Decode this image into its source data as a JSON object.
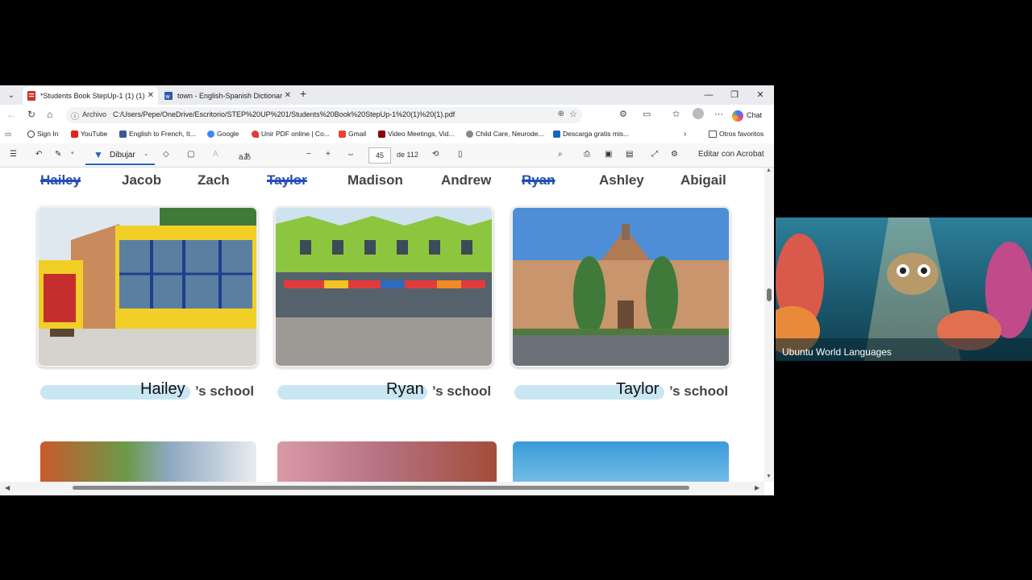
{
  "browser": {
    "tabs": [
      {
        "title": "*Students Book StepUp-1 (1) (1).p",
        "active": true
      },
      {
        "title": "town - English-Spanish Dictionar",
        "active": false
      }
    ],
    "address": {
      "label": "Archivo",
      "url": "C:/Users/Pepe/OneDrive/Escritorio/STEP%20UP%201/Students%20Book%20StepUp-1%20(1)%20(1).pdf"
    },
    "chat_label": "Chat",
    "bookmarks": [
      {
        "label": "Sign In",
        "color": "#333333"
      },
      {
        "label": "YouTube",
        "color": "#e62117"
      },
      {
        "label": "English to French, It...",
        "color": "#3b5998"
      },
      {
        "label": "Google",
        "color": "#4285f4"
      },
      {
        "label": "Unir PDF online | Co...",
        "color": "#e53935"
      },
      {
        "label": "Gmail",
        "color": "#ea4335"
      },
      {
        "label": "Video Meetings, Vid...",
        "color": "#8b0000"
      },
      {
        "label": "Child Care, Neurode...",
        "color": "#888888"
      },
      {
        "label": "Descarga gratis mis...",
        "color": "#1565c0"
      }
    ],
    "other_favorites": "Otros favoritos"
  },
  "pdf_toolbar": {
    "draw_label": "Dibujar",
    "page_current": "45",
    "page_total": "de 112",
    "read_aloud": "aあ",
    "edit_acrobat": "Editar con Acrobat"
  },
  "worksheet": {
    "names": [
      {
        "text": "Hailey",
        "struck": true
      },
      {
        "text": "Jacob",
        "struck": false
      },
      {
        "text": "Zach",
        "struck": false
      },
      {
        "text": "Taylor",
        "struck": true
      },
      {
        "text": "Madison",
        "struck": false
      },
      {
        "text": "Andrew",
        "struck": false
      },
      {
        "text": "Ryan",
        "struck": true
      },
      {
        "text": "Ashley",
        "struck": false
      },
      {
        "text": "Abigail",
        "struck": false
      }
    ],
    "school_suffix": "’s school",
    "answers": [
      "Hailey",
      "Ryan",
      "Taylor"
    ]
  },
  "video": {
    "caption": "Ubuntu World Languages"
  },
  "colors": {
    "accent": "#2563c6",
    "answer_bar": "#c9e6f3",
    "strike": "#1f4fbf"
  }
}
